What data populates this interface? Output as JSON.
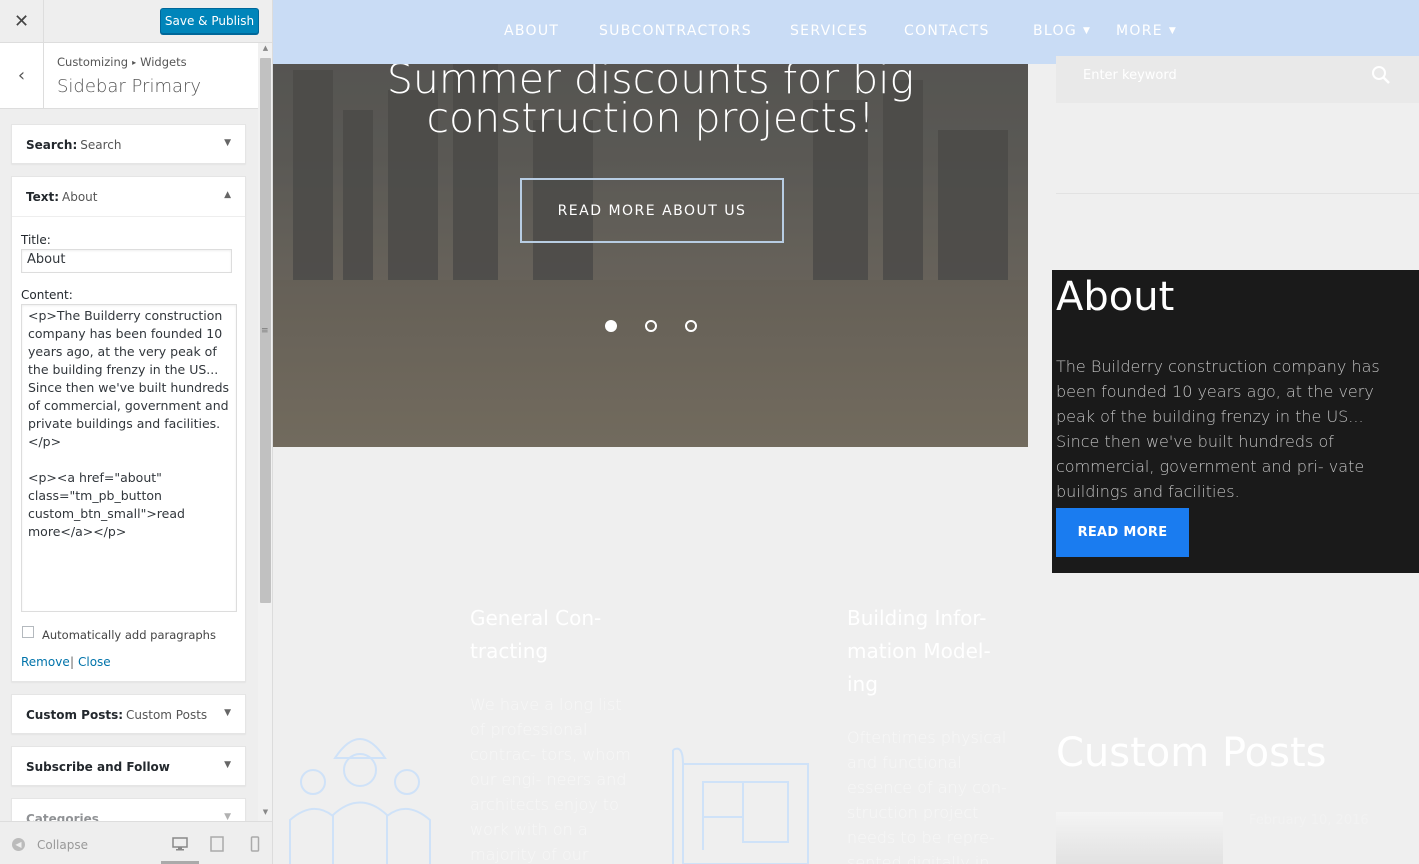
{
  "customizer": {
    "close_icon": "close-icon",
    "save_label": "Save & Publish",
    "breadcrumb": [
      "Customizing",
      "Widgets"
    ],
    "section_title": "Sidebar Primary",
    "widgets": {
      "search": {
        "type": "Search:",
        "name": "Search"
      },
      "text": {
        "type": "Text:",
        "name": "About",
        "title_label": "Title:",
        "title_value": "About",
        "content_label": "Content:",
        "content_value": "<p>The Builderry construction company has been founded 10 years ago, at the very peak of the building frenzy in the US... Since then we've built hundreds of commercial, government and private buildings and facilities.</p>\n\n<p><a href=\"about\" class=\"tm_pb_button custom_btn_small\">read more</a></p>",
        "autop_label": "Automatically add paragraphs",
        "autop_checked": false,
        "remove_label": "Remove",
        "separator": "|",
        "close_label": "Close"
      },
      "custom_posts": {
        "type": "Custom Posts:",
        "name": "Custom Posts"
      },
      "subscribe": {
        "type": "Subscribe and Follow",
        "name": ""
      },
      "categories": {
        "type": "Categories",
        "name": ""
      }
    },
    "footer": {
      "collapse_label": "Collapse",
      "devices": [
        "desktop",
        "tablet",
        "mobile"
      ],
      "active_device": "desktop"
    }
  },
  "preview": {
    "nav": [
      "ABOUT",
      "SUBCONTRACTORS",
      "SERVICES",
      "CONTACTS",
      "BLOG",
      "MORE"
    ],
    "hero": {
      "title": "Summer discounts for big construction projects!",
      "button": "READ MORE ABOUT US",
      "slides": 3,
      "active_slide": 1
    },
    "search_placeholder": "Enter keyword",
    "about": {
      "title": "About",
      "text": "The Builderry construction company has been founded 10 years ago, at the very peak of the building frenzy in the US... Since then we've built hundreds of commercial, government and pri- vate buildings and facilities.",
      "button": "READ MORE"
    },
    "services": [
      {
        "title": "General Con- tracting",
        "text": "We have a long list of professional contrac- tors, whom our engi- neers and architects enjoy to work with on a majority of our projects."
      },
      {
        "title": "Building Infor- mation Model- ing",
        "text": "Oftentimes physical and functional essence of any con- struction project needs to be repre- sented digitally in"
      }
    ],
    "custom_posts": {
      "title": "Custom Posts",
      "date": "February 10, 2016"
    },
    "colors": {
      "nav_bg": "#c9dcf5",
      "accent": "#1a7cf0",
      "save_button": "#0085ba",
      "about_bg": "#1a1a1a"
    }
  }
}
